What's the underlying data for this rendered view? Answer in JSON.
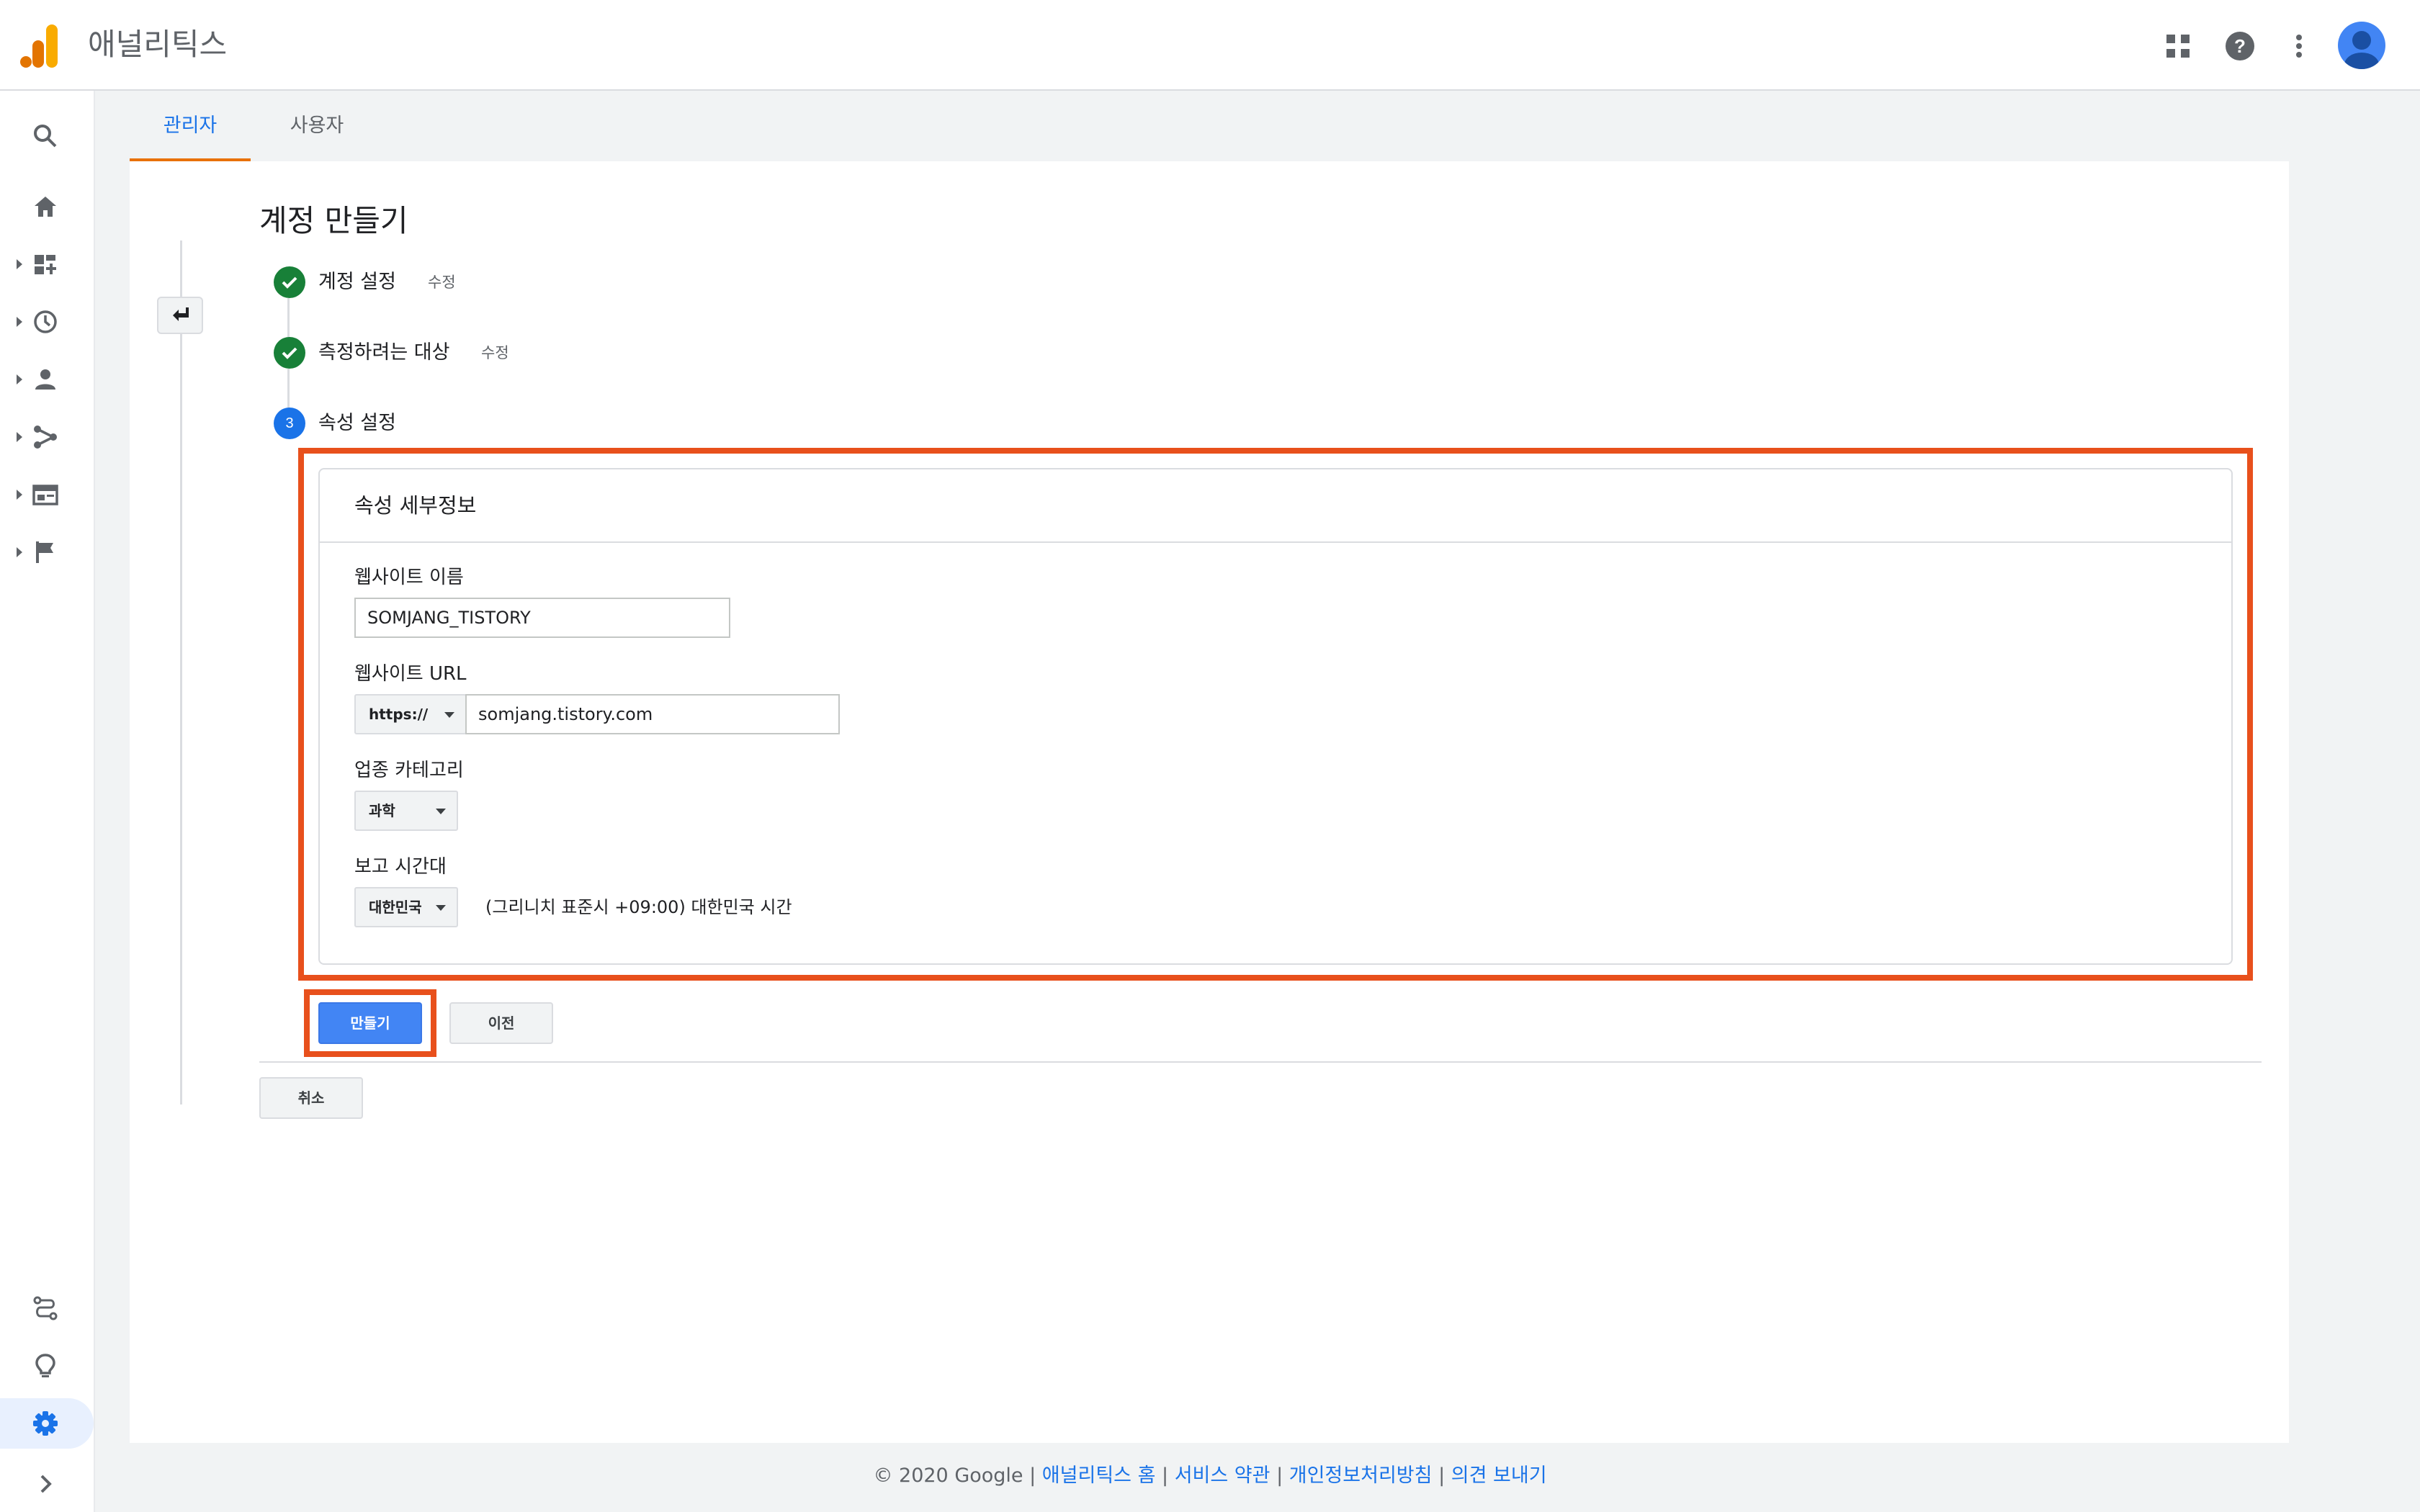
{
  "app": {
    "title": "애널리틱스",
    "logo_icon": "google-analytics-logo",
    "colors": {
      "logo_orange_dark": "#e37400",
      "logo_orange_light": "#f9ab00",
      "accent": "#1a73e8",
      "highlight": "#e8501c",
      "success": "#188038"
    }
  },
  "header": {
    "icons": [
      "apps-grid-icon",
      "help-icon",
      "more-vert-icon",
      "account-avatar"
    ]
  },
  "sidebar": {
    "items": [
      {
        "icon": "search-icon",
        "has_caret": false
      },
      {
        "icon": "home-icon",
        "has_caret": false
      },
      {
        "icon": "customization-icon",
        "has_caret": true
      },
      {
        "icon": "realtime-clock-icon",
        "has_caret": true
      },
      {
        "icon": "audience-person-icon",
        "has_caret": true
      },
      {
        "icon": "acquisition-icon",
        "has_caret": true
      },
      {
        "icon": "behavior-icon",
        "has_caret": true
      },
      {
        "icon": "conversions-flag-icon",
        "has_caret": true
      }
    ],
    "bottom_items": [
      {
        "icon": "attribution-icon"
      },
      {
        "icon": "discover-lightbulb-icon"
      },
      {
        "icon": "admin-gear-icon",
        "active": true
      },
      {
        "icon": "expand-chevron-icon"
      }
    ]
  },
  "tabs": [
    {
      "label": "관리자",
      "active": true
    },
    {
      "label": "사용자",
      "active": false
    }
  ],
  "page": {
    "title": "계정 만들기",
    "steps": [
      {
        "label": "계정 설정",
        "status": "complete",
        "edit_label": "수정"
      },
      {
        "label": "측정하려는 대상",
        "status": "complete",
        "edit_label": "수정"
      },
      {
        "label": "속성 설정",
        "status": "current",
        "number": "3"
      }
    ]
  },
  "property_details": {
    "title": "속성 세부정보",
    "website_name_label": "웹사이트 이름",
    "website_name_value": "SOMJANG_TISTORY",
    "website_url_label": "웹사이트 URL",
    "protocol_value": "https://",
    "website_url_value": "somjang.tistory.com",
    "industry_label": "업종 카테고리",
    "industry_value": "과학",
    "timezone_label": "보고 시간대",
    "timezone_country": "대한민국",
    "timezone_value": "(그리니치 표준시 +09:00) 대한민국 시간"
  },
  "actions": {
    "create_label": "만들기",
    "previous_label": "이전",
    "cancel_label": "취소"
  },
  "footer": {
    "copyright": "© 2020 Google",
    "separator": " | ",
    "links": [
      "애널리틱스 홈",
      "서비스 약관",
      "개인정보처리방침",
      "의견 보내기"
    ]
  }
}
